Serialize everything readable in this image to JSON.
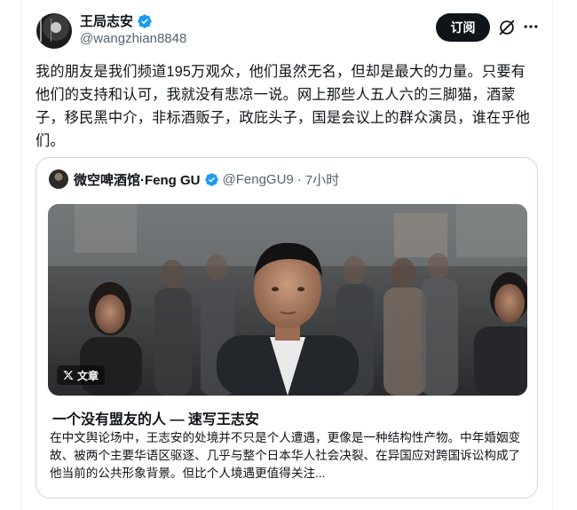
{
  "tweet": {
    "author": {
      "display_name": "王局志安",
      "handle": "@wangzhian8848",
      "verified": true,
      "avatar_icon": "avatar-photo"
    },
    "subscribe_label": "订阅",
    "text": "我的朋友是我们频道195万观众，他们虽然无名，但却是最大的力量。只要有他们的支持和认可，我就没有悲凉一说。网上那些人五人六的三脚猫，酒蒙子，移民黑中介，非标酒贩子，政庇头子，国是会议上的群众演员，谁在乎他们。"
  },
  "quote": {
    "author": {
      "display_name": "微空啤酒馆·Feng GU",
      "handle": "@FengGU9",
      "separator": "·",
      "time": "7小时",
      "verified": true
    },
    "article": {
      "badge_label": "文章",
      "title": "一个没有盟友的人 — 速写王志安",
      "excerpt": "在中文舆论场中，王志安的处境并不只是个人遭遇，更像是一种结构性产物。中年婚姻变故、被两个主要华语区驱逐、几乎与整个日本华人社会决裂、在异国应对跨国诉讼构成了他当前的公共形象背景。但比个人境遇更值得关注..."
    }
  },
  "colors": {
    "text_primary": "#0f1419",
    "text_secondary": "#536471",
    "verified_blue": "#1d9bf0",
    "border": "#cfd9de",
    "button_bg": "#0f1419"
  }
}
